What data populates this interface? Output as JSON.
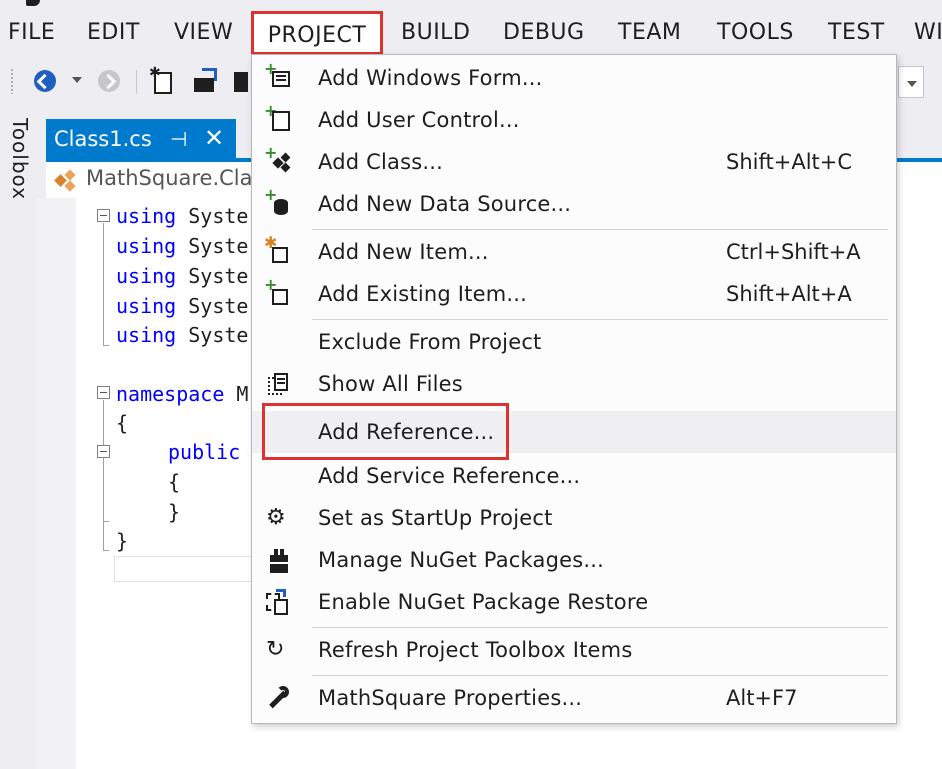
{
  "menubar": {
    "items": [
      "FILE",
      "EDIT",
      "VIEW",
      "PROJECT",
      "BUILD",
      "DEBUG",
      "TEAM",
      "TOOLS",
      "TEST",
      "WI"
    ]
  },
  "toolbar": {
    "icons": [
      "back-arrow-icon",
      "forward-arrow-icon",
      "new-project-icon",
      "open-file-icon",
      "save-icon"
    ]
  },
  "toolbox": {
    "label": "Toolbox"
  },
  "document_tab": {
    "title": "Class1.cs",
    "pin_glyph": "⊣",
    "close_glyph": "✕"
  },
  "navigation_bar": {
    "path": "MathSquare.Cla"
  },
  "editor": {
    "lines": [
      {
        "keyword": "using",
        "text": " Syste"
      },
      {
        "keyword": "using",
        "text": " Syste"
      },
      {
        "keyword": "using",
        "text": " Syste"
      },
      {
        "keyword": "using",
        "text": " Syste"
      },
      {
        "keyword": "using",
        "text": " Syste"
      },
      {
        "keyword": "namespace",
        "text": " M"
      },
      {
        "keyword": "",
        "text": "{"
      },
      {
        "keyword": "public",
        "text": ""
      },
      {
        "keyword": "",
        "text": "{"
      },
      {
        "keyword": "",
        "text": "}"
      },
      {
        "keyword": "",
        "text": "}"
      }
    ]
  },
  "project_menu": {
    "items": [
      {
        "label": "Add Windows Form...",
        "shortcut": "",
        "icon": "add-windows-form-icon"
      },
      {
        "label": "Add User Control...",
        "shortcut": "",
        "icon": "add-user-control-icon"
      },
      {
        "label": "Add Class...",
        "shortcut": "Shift+Alt+C",
        "icon": "add-class-icon"
      },
      {
        "label": "Add New Data Source...",
        "shortcut": "",
        "icon": "add-data-source-icon"
      },
      {
        "label": "Add New Item...",
        "shortcut": "Ctrl+Shift+A",
        "icon": "add-new-item-icon"
      },
      {
        "label": "Add Existing Item...",
        "shortcut": "Shift+Alt+A",
        "icon": "add-existing-item-icon"
      },
      {
        "label": "Exclude From Project",
        "shortcut": "",
        "icon": ""
      },
      {
        "label": "Show All Files",
        "shortcut": "",
        "icon": "show-all-files-icon"
      },
      {
        "label": "Add Reference...",
        "shortcut": "",
        "icon": ""
      },
      {
        "label": "Add Service Reference...",
        "shortcut": "",
        "icon": ""
      },
      {
        "label": "Set as StartUp Project",
        "shortcut": "",
        "icon": "gear-icon"
      },
      {
        "label": "Manage NuGet Packages...",
        "shortcut": "",
        "icon": "nuget-package-icon"
      },
      {
        "label": "Enable NuGet Package Restore",
        "shortcut": "",
        "icon": "package-restore-icon"
      },
      {
        "label": "Refresh Project Toolbox Items",
        "shortcut": "",
        "icon": "refresh-icon"
      },
      {
        "label": "MathSquare Properties...",
        "shortcut": "Alt+F7",
        "icon": "wrench-icon"
      }
    ]
  },
  "colors": {
    "highlight_box": "#e03131",
    "tab_active": "#007acc",
    "keyword": "#0000ff",
    "background": "#eeeef2"
  }
}
